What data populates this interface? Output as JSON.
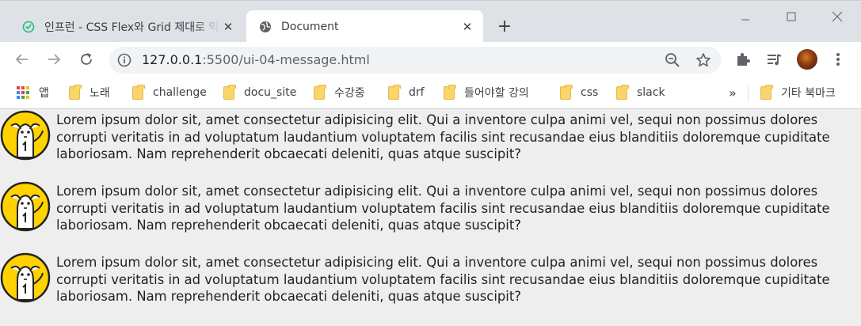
{
  "tabs": [
    {
      "title": "인프런 - CSS Flex와 Grid 제대로 익히기",
      "favicon": "inflearn-icon",
      "active": false
    },
    {
      "title": "Document",
      "favicon": "globe-icon",
      "active": true
    }
  ],
  "toolbar": {
    "url_host": "127.0.0.1",
    "url_rest": ":5500/ui-04-message.html"
  },
  "bookmarks": {
    "apps_label": "앱",
    "items": [
      "노래",
      "challenge",
      "docu_site",
      "수강중",
      "drf",
      "들어야할 강의",
      "css",
      "slack"
    ],
    "overflow": "»",
    "other": "기타 북마크"
  },
  "messages": [
    {
      "text": "Lorem ipsum dolor sit, amet consectetur adipisicing elit. Qui a inventore culpa animi vel, sequi non possimus dolores corrupti veritatis in ad voluptatum laudantium voluptatem facilis sint recusandae eius blanditiis doloremque cupiditate laboriosam. Nam reprehenderit obcaecati deleniti, quas atque suscipit?",
      "avatar": "character-avatar-icon"
    },
    {
      "text": "Lorem ipsum dolor sit, amet consectetur adipisicing elit. Qui a inventore culpa animi vel, sequi non possimus dolores corrupti veritatis in ad voluptatum laudantium voluptatem facilis sint recusandae eius blanditiis doloremque cupiditate laboriosam. Nam reprehenderit obcaecati deleniti, quas atque suscipit?",
      "avatar": "character-avatar-icon"
    },
    {
      "text": "Lorem ipsum dolor sit, amet consectetur adipisicing elit. Qui a inventore culpa animi vel, sequi non possimus dolores corrupti veritatis in ad voluptatum laudantium voluptatem facilis sint recusandae eius blanditiis doloremque cupiditate laboriosam. Nam reprehenderit obcaecati deleniti, quas atque suscipit?",
      "avatar": "character-avatar-icon"
    }
  ],
  "colors": {
    "tabstrip": "#dee1e6",
    "page_background": "#eeeeee",
    "avatar_yellow": "#ffd200"
  }
}
